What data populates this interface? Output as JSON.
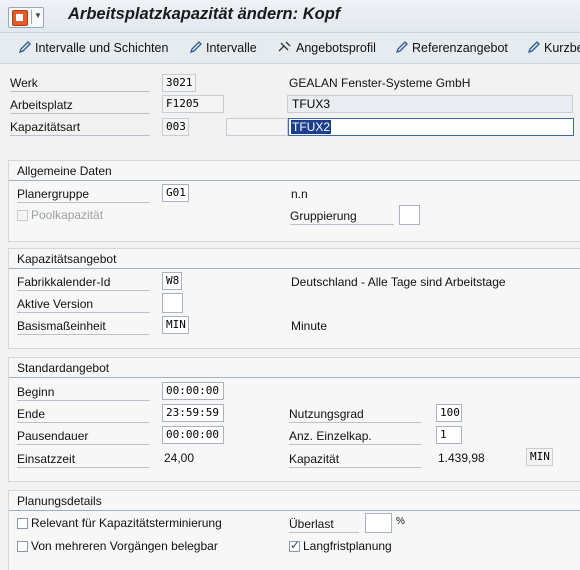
{
  "window": {
    "title": "Arbeitsplatzkapazität ändern: Kopf"
  },
  "toolbar": {
    "buttons": [
      {
        "label": "Intervalle und Schichten",
        "icon": "pencil-icon"
      },
      {
        "label": "Intervalle",
        "icon": "pencil-icon"
      },
      {
        "label": "Angebotsprofil",
        "icon": "tools-icon"
      },
      {
        "label": "Referenzangebot",
        "icon": "pencil-icon"
      },
      {
        "label": "Kurzbe",
        "icon": "pencil-icon"
      }
    ]
  },
  "header": {
    "werk_label": "Werk",
    "werk_value": "3021",
    "werk_desc": "GEALAN Fenster-Systeme GmbH",
    "arbeitsplatz_label": "Arbeitsplatz",
    "arbeitsplatz_value": "F1205",
    "arbeitsplatz_desc": "TFUX3",
    "kapazitaetsart_label": "Kapazitätsart",
    "kapazitaetsart_value": "003",
    "kapazitaetsart_desc": "TFUX2"
  },
  "allgemeine": {
    "title": "Allgemeine Daten",
    "planergruppe_label": "Planergruppe",
    "planergruppe_value": "G01",
    "planergruppe_desc": "n.n",
    "poolkapazitaet_label": "Poolkapazität",
    "poolkapazitaet_checked": false,
    "gruppierung_label": "Gruppierung",
    "gruppierung_value": ""
  },
  "kapazitaetsangebot": {
    "title": "Kapazitätsangebot",
    "fabrikkalender_label": "Fabrikkalender-Id",
    "fabrikkalender_value": "W8",
    "fabrikkalender_desc": "Deutschland - Alle Tage sind Arbeitstage",
    "aktive_version_label": "Aktive Version",
    "aktive_version_value": "",
    "basismasseinheit_label": "Basismaßeinheit",
    "basismasseinheit_value": "MIN",
    "basismasseinheit_desc": "Minute"
  },
  "standardangebot": {
    "title": "Standardangebot",
    "beginn_label": "Beginn",
    "beginn_value": "00:00:00",
    "ende_label": "Ende",
    "ende_value": "23:59:59",
    "pausendauer_label": "Pausendauer",
    "pausendauer_value": "00:00:00",
    "einsatzzeit_label": "Einsatzzeit",
    "einsatzzeit_value": "24,00",
    "nutzungsgrad_label": "Nutzungsgrad",
    "nutzungsgrad_value": "100",
    "einzelkap_label": "Anz. Einzelkap.",
    "einzelkap_value": "1",
    "kapazitaet_label": "Kapazität",
    "kapazitaet_value": "1.439,98",
    "kapazitaet_unit": "MIN"
  },
  "planungsdetails": {
    "title": "Planungsdetails",
    "relevant_label": "Relevant für Kapazitätsterminierung",
    "relevant_checked": false,
    "mehreren_label": "Von mehreren Vorgängen belegbar",
    "mehreren_checked": false,
    "ueberlast_label": "Überlast",
    "ueberlast_value": "",
    "ueberlast_unit": "%",
    "langfrist_label": "Langfristplanung",
    "langfrist_checked": true,
    "langfrist_mark": "✓"
  }
}
